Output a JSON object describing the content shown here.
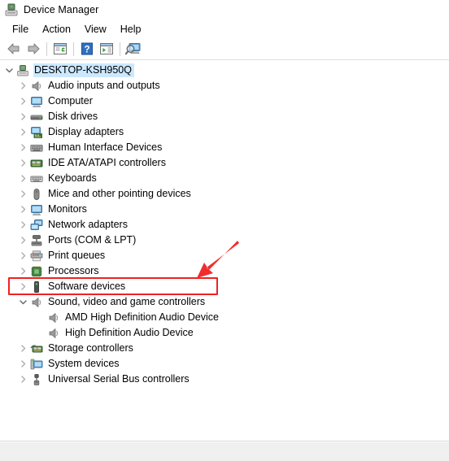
{
  "window": {
    "title": "Device Manager",
    "icon": "device-manager-icon"
  },
  "menu": {
    "items": [
      {
        "label": "File"
      },
      {
        "label": "Action"
      },
      {
        "label": "View"
      },
      {
        "label": "Help"
      }
    ]
  },
  "toolbar": {
    "buttons": [
      {
        "icon": "back-arrow-icon",
        "label": "Back"
      },
      {
        "icon": "forward-arrow-icon",
        "label": "Forward"
      },
      {
        "icon": "properties-icon",
        "label": "Properties"
      },
      {
        "icon": "help-icon",
        "label": "Help"
      },
      {
        "icon": "show-hidden-devices-icon",
        "label": "Show hidden devices"
      },
      {
        "icon": "scan-hardware-changes-icon",
        "label": "Scan for hardware changes"
      }
    ]
  },
  "tree": {
    "root": {
      "label": "DESKTOP-KSH950Q",
      "icon": "computer-root-icon",
      "expanded": true,
      "selected": true
    },
    "nodes": [
      {
        "label": "Audio inputs and outputs",
        "icon": "speaker-icon",
        "expanded": false
      },
      {
        "label": "Computer",
        "icon": "monitor-icon",
        "expanded": false
      },
      {
        "label": "Disk drives",
        "icon": "disk-drive-icon",
        "expanded": false
      },
      {
        "label": "Display adapters",
        "icon": "display-adapter-icon",
        "expanded": false
      },
      {
        "label": "Human Interface Devices",
        "icon": "hid-icon",
        "expanded": false
      },
      {
        "label": "IDE ATA/ATAPI controllers",
        "icon": "ide-controller-icon",
        "expanded": false
      },
      {
        "label": "Keyboards",
        "icon": "keyboard-icon",
        "expanded": false
      },
      {
        "label": "Mice and other pointing devices",
        "icon": "mouse-icon",
        "expanded": false
      },
      {
        "label": "Monitors",
        "icon": "monitor-icon",
        "expanded": false
      },
      {
        "label": "Network adapters",
        "icon": "network-adapter-icon",
        "expanded": false
      },
      {
        "label": "Ports (COM & LPT)",
        "icon": "port-icon",
        "expanded": false
      },
      {
        "label": "Print queues",
        "icon": "printer-icon",
        "expanded": false
      },
      {
        "label": "Processors",
        "icon": "processor-icon",
        "expanded": false
      },
      {
        "label": "Software devices",
        "icon": "software-device-icon",
        "expanded": false
      },
      {
        "label": "Sound, video and game controllers",
        "icon": "speaker-icon",
        "expanded": true,
        "highlighted": true,
        "children": [
          {
            "label": "AMD High Definition Audio Device",
            "icon": "speaker-icon"
          },
          {
            "label": "High Definition Audio Device",
            "icon": "speaker-icon"
          }
        ]
      },
      {
        "label": "Storage controllers",
        "icon": "storage-controller-icon",
        "expanded": false
      },
      {
        "label": "System devices",
        "icon": "system-device-icon",
        "expanded": false
      },
      {
        "label": "Universal Serial Bus controllers",
        "icon": "usb-icon",
        "expanded": false
      }
    ]
  },
  "statusbar": {
    "text": ""
  },
  "annotation": {
    "highlight_color": "#ee2222",
    "arrow_color": "#f22d2d",
    "selection_color": "#cce8ff"
  }
}
